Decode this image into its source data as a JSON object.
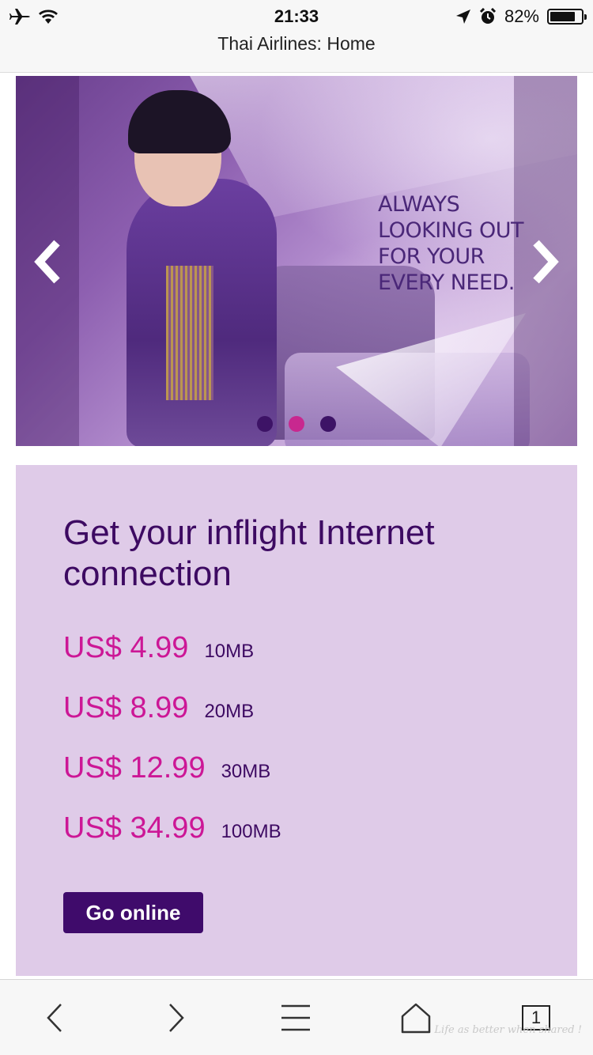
{
  "status_bar": {
    "time": "21:33",
    "battery_percent": "82%",
    "battery_level": 0.82,
    "icons": [
      "airplane-icon",
      "wifi-icon",
      "location-arrow-icon",
      "alarm-icon",
      "battery-icon"
    ]
  },
  "browser": {
    "page_title": "Thai Airlines: Home",
    "tab_count": "1"
  },
  "hero": {
    "slogan_lines": [
      "ALWAYS",
      "LOOKING OUT",
      "FOR YOUR",
      "EVERY NEED."
    ],
    "slide_count": 3,
    "active_slide": 2
  },
  "internet_panel": {
    "title": "Get your inflight Internet connection",
    "plans": [
      {
        "price": "US$ 4.99",
        "size": "10MB"
      },
      {
        "price": "US$ 8.99",
        "size": "20MB"
      },
      {
        "price": "US$ 12.99",
        "size": "30MB"
      },
      {
        "price": "US$ 34.99",
        "size": "100MB"
      }
    ],
    "button_label": "Go online"
  },
  "watermark": "Life as better when shared !",
  "colors": {
    "brand_purple": "#3f0b6b",
    "price_magenta": "#cc1796",
    "panel_background": "#dfcbe8",
    "active_dot": "#c8288f"
  }
}
